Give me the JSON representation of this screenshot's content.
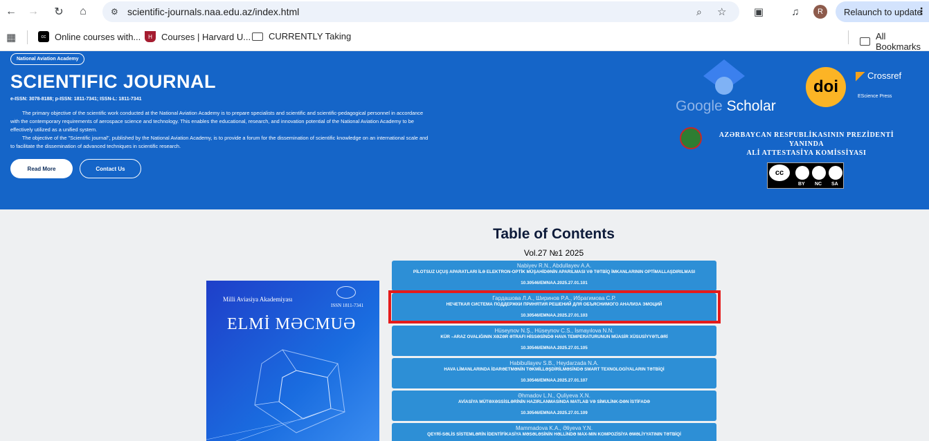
{
  "browser": {
    "url": "scientific-journals.naa.edu.az/index.html",
    "relaunch_label": "Relaunch to update",
    "avatar_letter": "R",
    "bookmarks": [
      {
        "label": "Online courses with...",
        "icon": "cc-icon"
      },
      {
        "label": "Courses | Harvard U...",
        "icon": "harvard-icon"
      },
      {
        "label": "CURRENTLY Taking",
        "icon": "folder-icon"
      }
    ],
    "all_bookmarks": "All Bookmarks"
  },
  "hero": {
    "badge": "National Aviation Academy",
    "title": "SCIENTIFIC JOURNAL",
    "issn": "e-ISSN: 3078-8188; p-ISSN: 1811-7341; ISSN-L: 1811-7341",
    "paragraph1": "The primary objective of the scientific work conducted at the National Aviation Academy is to prepare specialists and scientific and scientific-pedagogical personnel in accordance with the contemporary requirements of aerospace science and technology. This enables the educational, research, and innovation potential of the National Aviation Academy to be effectively utilized as a unified system.",
    "paragraph2": "The objective of the \"Scientific journal\", published by the National Aviation Academy, is to provide a forum for the dissemination of scientific knowledge on an international scale and to facilitate the dissemination of advanced techniques in scientific research.",
    "read_more": "Read More",
    "contact_us": "Contact Us",
    "logos": {
      "google": "Google",
      "scholar": "Scholar",
      "doi": "doi",
      "crossref": "Crossref",
      "escience": "EScience Press",
      "aak_line1": "AZƏRBAYCAN RESPUBLİKASININ PREZİDENTİ YANINDA",
      "aak_line2": "ALİ ATTESTASİYA KOMİSSİYASI",
      "cc_by": "BY",
      "cc_nc": "NC",
      "cc_sa": "SA"
    }
  },
  "cover": {
    "publisher": "Milli Aviasiya Akademiyası",
    "issn": "ISSN 1811-7341",
    "title": "ELMİ MƏCMUƏ"
  },
  "toc": {
    "title": "Table of Contents",
    "volume": "Vol.27 №1 2025",
    "articles": [
      {
        "authors": "Nabiyev R.N., Abdullayev A.A.",
        "title": "PİLOTSUZ UÇUŞ APARATLARI İLƏ ELEKTRON-OPTİK MÜŞAHİDƏNİN APARILMASI VƏ TƏTBİQ İMKANLARININ OPTİMALLAŞDIRILMASI",
        "doi": "10.30546/EMNAA.2025.27.01.101"
      },
      {
        "authors": "Гардашова Л.А., Ширинов Р.А., Ибрагимова С.Р.",
        "title": "НЕЧЕТКАЯ СИСТЕМА ПОДДЕРЖКИ ПРИНЯТИЯ РЕШЕНИЙ ДЛЯ ОБЪЯСНИМОГО АНАЛИЗА ЭМОЦИЙ",
        "doi": "10.30546/EMNAA.2025.27.01.103"
      },
      {
        "authors": "Hüseynov N.Ş., Hüseynov C.S., İsmayılova N.N.",
        "title": "KÜR –ARAZ OVALIĞININ XƏZƏR ƏTRAFI HİSSƏSİNDƏ HAVA TEMPERATURUNUN MÜASİR XÜSUSİYYƏTLƏRİ",
        "doi": "10.30546/EMNAA.2025.27.01.105"
      },
      {
        "authors": "Habibullayev S.B., Heydarzada N.A.",
        "title": "HAVA LİMANLARINDA İDARƏETMƏNİN TƏKMİLLƏŞDİRİLMƏSİNDƏ SMART TEXNOLOGİYALARIN TƏTBİQİ",
        "doi": "10.30546/EMNAA.2025.27.01.107"
      },
      {
        "authors": "Əhmadov L.N., Quliyeva X.N.",
        "title": "AVİASİYA MÜTƏXƏSSİSLƏRİNİN HAZIRLANMASINDA MATLAB VƏ SİMULİNK-DƏN İSTİFADƏ",
        "doi": "10.30546/EMNAA.2025.27.01.109"
      },
      {
        "authors": "Mammadova K.A., Əliyeva Y.N.",
        "title": "QEYRİ-SƏLİS SİSTEMLƏRİN İDENTİFİKASİYA MƏSƏLƏSİNİN HƏLLİNDƏ max-min KOMPOZİSİYA ƏMƏLİYYATININ TƏTBİQİ",
        "doi": ""
      }
    ]
  },
  "colors": {
    "hero_bg": "#1565c8",
    "article_bg": "#2d8fd6",
    "highlight": "#e41b1b"
  }
}
